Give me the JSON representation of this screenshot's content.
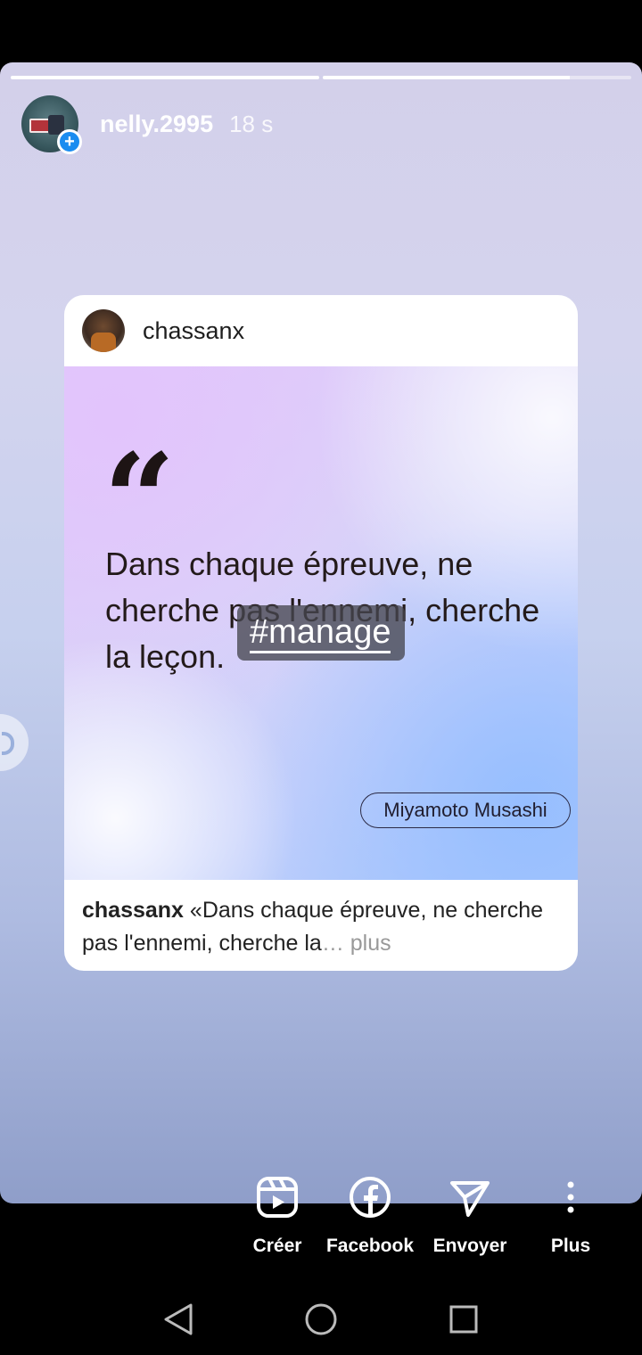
{
  "story": {
    "progress": [
      1.0,
      0.8
    ],
    "username": "nelly.2995",
    "time": "18 s",
    "plus_badge": "+"
  },
  "card": {
    "author_name": "chassanx",
    "quote_mark": "“",
    "quote_text": "Dans chaque épreuve, ne cherche pas l'ennemi, cherche la leçon.",
    "hashtag": "#manage",
    "quote_author": "Miyamoto Musashi",
    "caption_user": "chassanx",
    "caption_text": "«Dans chaque épreuve, ne cherche pas l'ennemi, cherche la",
    "caption_ellipsis": "…",
    "caption_more": "plus"
  },
  "actions": [
    {
      "label": "Créer",
      "icon": "reels-icon"
    },
    {
      "label": "Facebook",
      "icon": "facebook-icon"
    },
    {
      "label": "Envoyer",
      "icon": "send-icon"
    },
    {
      "label": "Plus",
      "icon": "more-vertical-icon"
    }
  ],
  "navbar": {
    "back": "back-icon",
    "home": "home-icon",
    "recents": "recents-icon"
  },
  "colors": {
    "badge": "#1a8cf0",
    "background": "#000000"
  }
}
